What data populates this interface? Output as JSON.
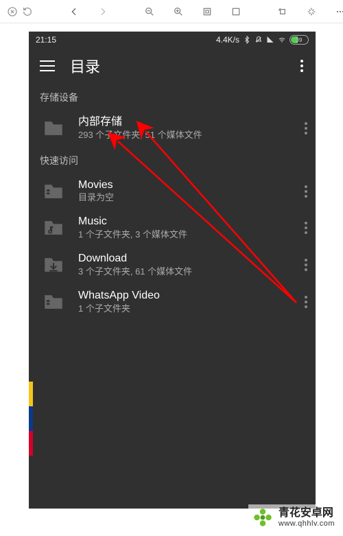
{
  "status_bar": {
    "time": "21:15",
    "net_speed": "4.4K/s",
    "battery_text": "39"
  },
  "app_bar": {
    "title": "目录"
  },
  "sections": {
    "storage_header": "存储设备",
    "quick_header": "快速访问"
  },
  "storage_item": {
    "title": "内部存储",
    "subtitle": "293 个子文件夹, 51 个媒体文件"
  },
  "quick_items": [
    {
      "title": "Movies",
      "subtitle": "目录为空",
      "icon": "video"
    },
    {
      "title": "Music",
      "subtitle": "1 个子文件夹, 3 个媒体文件",
      "icon": "music"
    },
    {
      "title": "Download",
      "subtitle": "3 个子文件夹, 61 个媒体文件",
      "icon": "download"
    },
    {
      "title": "WhatsApp Video",
      "subtitle": "1 个子文件夹",
      "icon": "video"
    }
  ],
  "watermark": {
    "cn": "青花安卓网",
    "url": "www.qhhlv.com"
  }
}
